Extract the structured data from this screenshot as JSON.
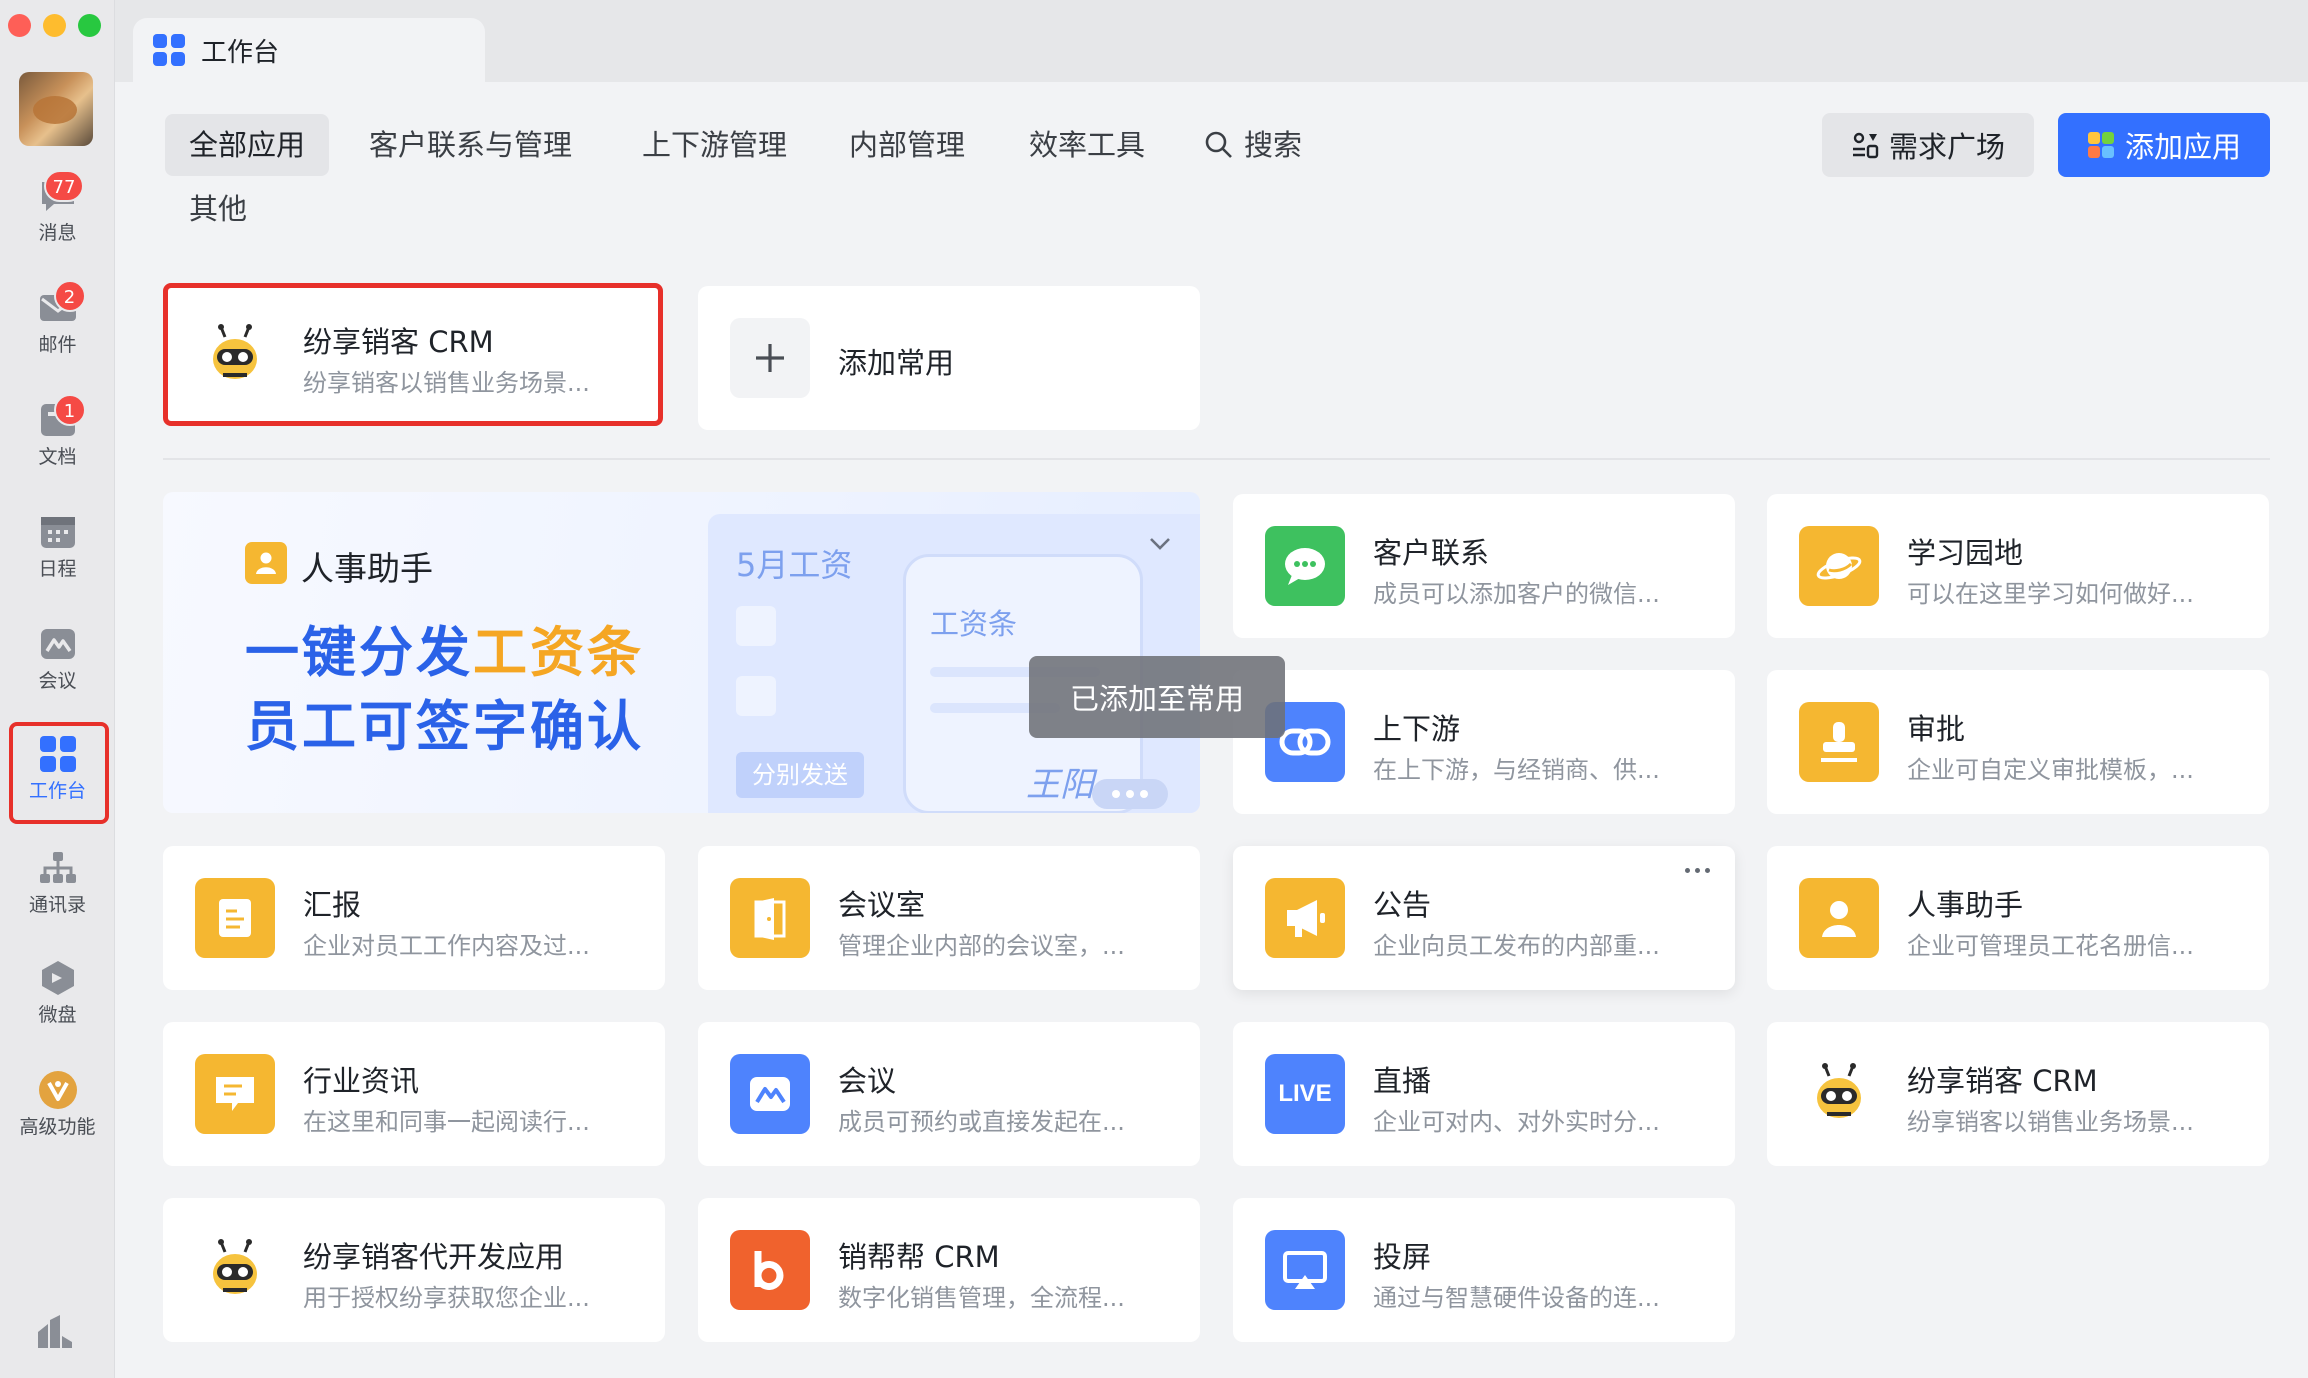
{
  "sidebar": {
    "items": [
      {
        "label": "消息",
        "badge": "77",
        "icon": "chat-bubble-icon"
      },
      {
        "label": "邮件",
        "badge": "2",
        "icon": "mail-icon"
      },
      {
        "label": "文档",
        "badge": "1",
        "icon": "document-icon"
      },
      {
        "label": "日程",
        "badge": "",
        "icon": "calendar-icon"
      },
      {
        "label": "会议",
        "badge": "",
        "icon": "meeting-icon"
      },
      {
        "label": "工作台",
        "badge": "",
        "icon": "workspace-grid-icon",
        "active": true
      },
      {
        "label": "通讯录",
        "badge": "",
        "icon": "org-chart-icon"
      },
      {
        "label": "微盘",
        "badge": "",
        "icon": "cloud-disk-icon"
      },
      {
        "label": "高级功能",
        "badge": "",
        "icon": "premium-icon"
      }
    ]
  },
  "tabbar": {
    "title": "工作台"
  },
  "categories": [
    "全部应用",
    "客户联系与管理",
    "上下游管理",
    "内部管理",
    "效率工具",
    "搜索",
    "其他"
  ],
  "header_buttons": {
    "demand": "需求广场",
    "add": "添加应用"
  },
  "favorites": {
    "crm": {
      "title": "纷享销客 CRM",
      "desc": "纷享销客以销售业务场景..."
    },
    "add_common": "添加常用"
  },
  "banner": {
    "title": "人事助手",
    "line1_a": "一键分发",
    "line1_b": "工资条",
    "line2": "员工可签字确认",
    "panel_title": "5月工资",
    "phone_title": "工资条",
    "send_label": "分别发送",
    "signature": "王阳"
  },
  "toast": "已添加至常用",
  "apps": [
    {
      "title": "客户联系",
      "desc": "成员可以添加客户的微信..."
    },
    {
      "title": "学习园地",
      "desc": "可以在这里学习如何做好..."
    },
    {
      "title": "上下游",
      "desc": "在上下游，与经销商、供..."
    },
    {
      "title": "审批",
      "desc": "企业可自定义审批模板，..."
    },
    {
      "title": "汇报",
      "desc": "企业对员工工作内容及过..."
    },
    {
      "title": "会议室",
      "desc": "管理企业内部的会议室，..."
    },
    {
      "title": "公告",
      "desc": "企业向员工发布的内部重..."
    },
    {
      "title": "人事助手",
      "desc": "企业可管理员工花名册信..."
    },
    {
      "title": "行业资讯",
      "desc": "在这里和同事一起阅读行..."
    },
    {
      "title": "会议",
      "desc": "成员可预约或直接发起在..."
    },
    {
      "title": "直播",
      "desc": "企业可对内、对外实时分...",
      "icon_text": "LIVE"
    },
    {
      "title": "纷享销客 CRM",
      "desc": "纷享销客以销售业务场景..."
    },
    {
      "title": "纷享销客代开发应用",
      "desc": "用于授权纷享获取您企业..."
    },
    {
      "title": "销帮帮 CRM",
      "desc": "数字化销售管理，全流程..."
    },
    {
      "title": "投屏",
      "desc": "通过与智慧硬件设备的连..."
    }
  ],
  "colors": {
    "accent": "#3370ff",
    "highlight": "#e7302a",
    "orange": "#f5b731",
    "green": "#3ec15f",
    "blue": "#4e83fd"
  }
}
